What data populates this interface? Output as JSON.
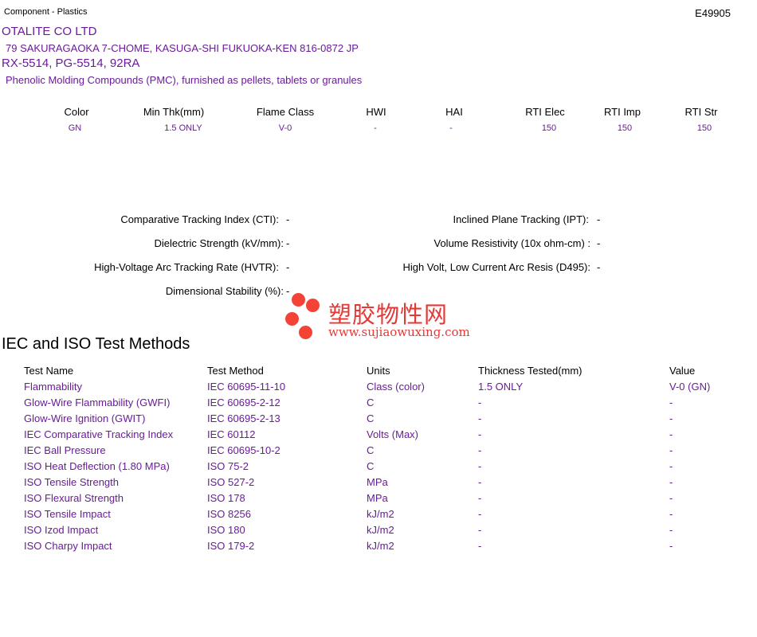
{
  "header": {
    "category": "Component - Plastics",
    "file_number": "E49905"
  },
  "company": {
    "name": "OTALITE CO LTD",
    "address": "79 SAKURAGAOKA 7-CHOME, KASUGA-SHI  FUKUOKA-KEN  816-0872 JP"
  },
  "product": {
    "grades": "RX-5514, PG-5514, 92RA",
    "description": "Phenolic Molding Compounds (PMC), furnished as pellets, tablets or granules"
  },
  "ratings": {
    "headers": [
      "Color",
      "Min Thk(mm)",
      "Flame Class",
      "HWI",
      "HAI",
      "RTI Elec",
      "RTI Imp",
      "RTI Str"
    ],
    "values": [
      "GN",
      "1.5 ONLY",
      "V-0",
      "-",
      "-",
      "150",
      "150",
      "150"
    ]
  },
  "properties": {
    "cti": {
      "label": "Comparative Tracking Index (CTI):",
      "value": "-"
    },
    "ipt": {
      "label": "Inclined Plane Tracking (IPT):",
      "value": "-"
    },
    "dielectric": {
      "label": "Dielectric Strength (kV/mm):",
      "value": "-"
    },
    "volume_res": {
      "label": "Volume Resistivity (10x ohm-cm) :",
      "value": "-"
    },
    "hvtr": {
      "label": "High-Voltage Arc Tracking Rate (HVTR):",
      "value": "-"
    },
    "d495": {
      "label": "High Volt, Low Current Arc Resis (D495):",
      "value": "-"
    },
    "dim_stab": {
      "label": "Dimensional Stability (%):",
      "value": "-"
    }
  },
  "watermark": {
    "text": "塑胶物性网",
    "url": "www.sujiaowuxing.com",
    "color": "#e53935"
  },
  "iso": {
    "title": "IEC and ISO Test Methods",
    "headers": [
      "Test Name",
      "Test Method",
      "Units",
      "Thickness Tested(mm)",
      "Value"
    ],
    "rows": [
      [
        "Flammability",
        "IEC 60695-11-10",
        "Class (color)",
        "1.5 ONLY",
        "V-0 (GN)"
      ],
      [
        "Glow-Wire Flammability (GWFI)",
        "IEC 60695-2-12",
        "C",
        "-",
        "-"
      ],
      [
        "Glow-Wire Ignition (GWIT)",
        "IEC 60695-2-13",
        "C",
        "-",
        "-"
      ],
      [
        "IEC Comparative Tracking Index",
        "IEC 60112",
        "Volts (Max)",
        "-",
        "-"
      ],
      [
        "IEC Ball Pressure",
        "IEC 60695-10-2",
        "C",
        "-",
        "-"
      ],
      [
        "ISO Heat Deflection (1.80 MPa)",
        "ISO 75-2",
        "C",
        "-",
        "-"
      ],
      [
        "ISO Tensile Strength",
        "ISO 527-2",
        "MPa",
        "-",
        "-"
      ],
      [
        "ISO Flexural Strength",
        "ISO 178",
        "MPa",
        "-",
        "-"
      ],
      [
        "ISO Tensile Impact",
        "ISO 8256",
        "kJ/m2",
        "-",
        "-"
      ],
      [
        "ISO Izod Impact",
        "ISO 180",
        "kJ/m2",
        "-",
        "-"
      ],
      [
        "ISO Charpy Impact",
        "ISO 179-2",
        "kJ/m2",
        "-",
        "-"
      ]
    ]
  },
  "colors": {
    "accent": "#6a1b9a",
    "text": "#000000"
  }
}
